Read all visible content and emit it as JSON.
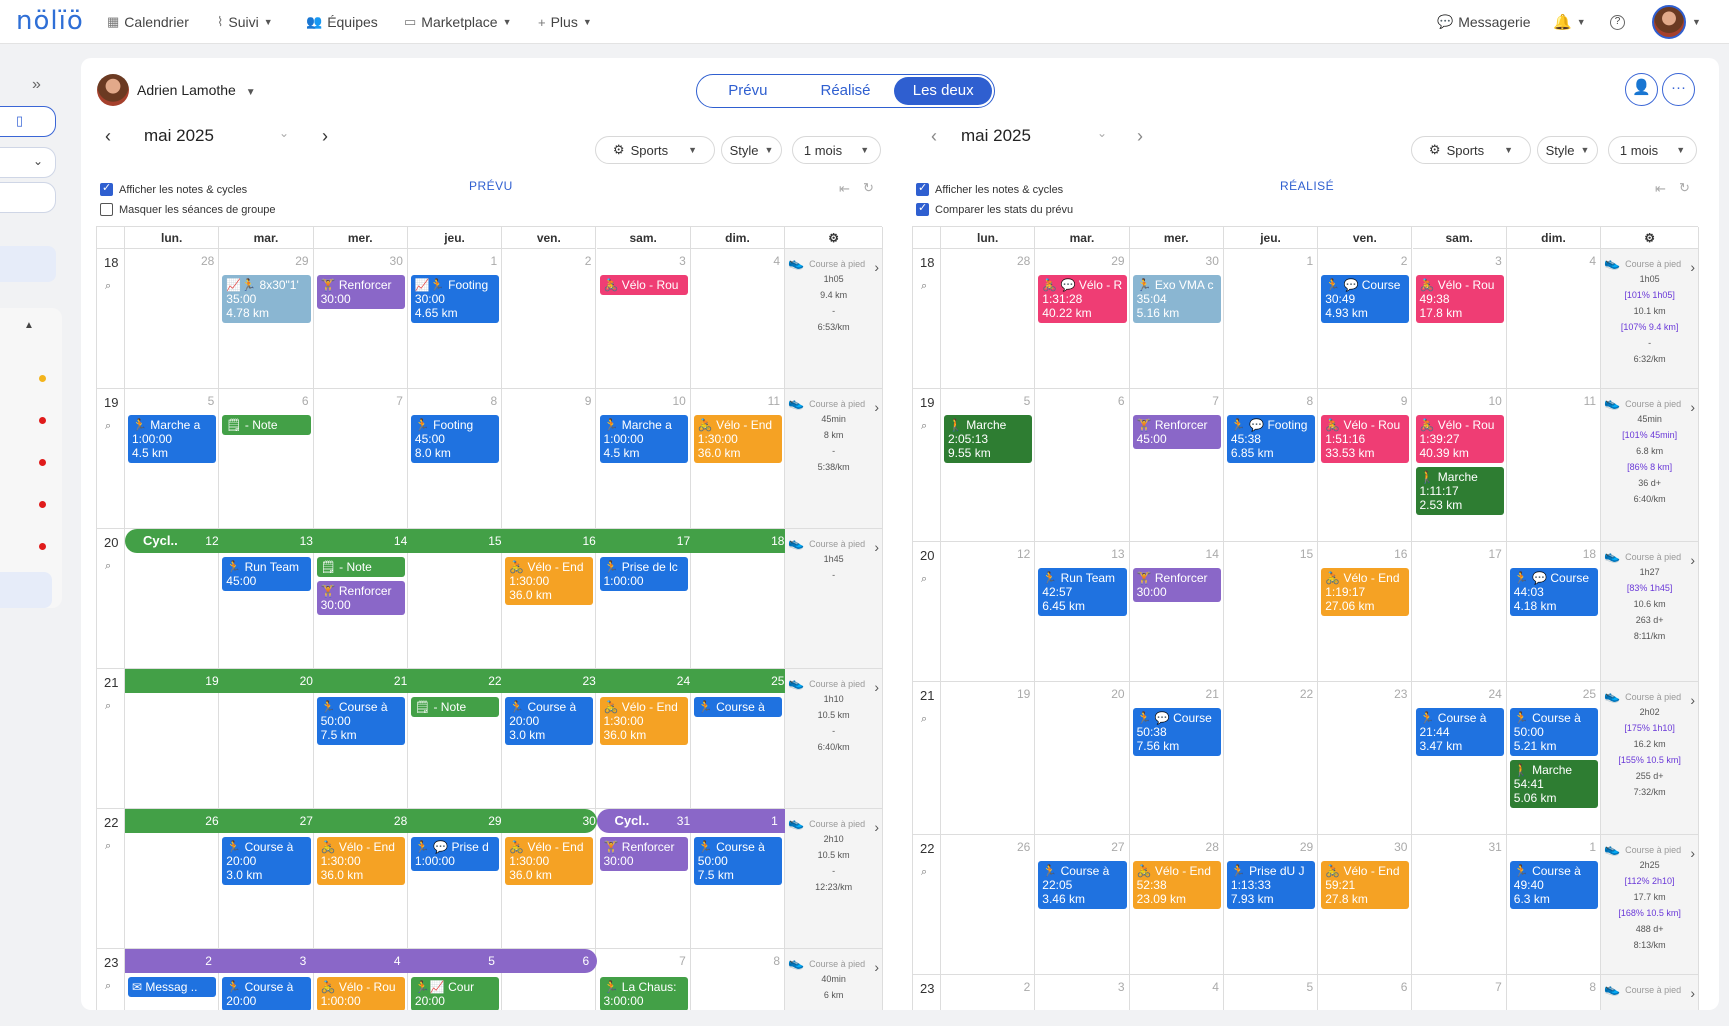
{
  "topbar": {
    "logo": "nölïö",
    "nav": [
      {
        "label": "Calendrier",
        "icon": "calendar-icon"
      },
      {
        "label": "Suivi",
        "icon": "chart-icon"
      },
      {
        "label": "Équipes",
        "icon": "team-icon"
      },
      {
        "label": "Marketplace",
        "icon": "shop-icon"
      },
      {
        "label": "Plus",
        "icon": "plus-icon"
      }
    ],
    "messaging": "Messagerie"
  },
  "athlete": "Adrien Lamothe",
  "view_toggle": [
    "Prévu",
    "Réalisé",
    "Les deux"
  ],
  "month": "mai 2025",
  "filters": {
    "sports": "Sports",
    "style": "Style",
    "period": "1 mois"
  },
  "left": {
    "title": "PRÉVU",
    "check1": "Afficher les notes & cycles",
    "check2": "Masquer les séances de groupe"
  },
  "right": {
    "title": "RÉALISÉ",
    "check1": "Afficher les notes & cycles",
    "check2": "Comparer les stats du prévu"
  },
  "weekdays": [
    "lun.",
    "mar.",
    "mer.",
    "jeu.",
    "ven.",
    "sam.",
    "dim."
  ],
  "colors": {
    "blue": "#1f72e0",
    "purple": "#8a67c8",
    "pink": "#ef3d74",
    "orange": "#f5a224",
    "light_blue": "#8ab6d2",
    "dark_green": "#2e7d32",
    "green": "#43a047"
  },
  "plan": {
    "weeks": [
      {
        "num": "18",
        "days": [
          "28",
          "29",
          "30",
          "1",
          "2",
          "3",
          "4"
        ],
        "stats": [
          "Course à pied",
          "1h05",
          "9.4 km",
          "-",
          "6:53/km"
        ],
        "events": [
          {
            "d": 1,
            "c": "lblue",
            "lines": [
              "📈🏃 8x30\"1'",
              "35:00",
              "4.78 km"
            ]
          },
          {
            "d": 2,
            "c": "purple",
            "lines": [
              "🏋 Renforcer",
              "30:00"
            ]
          },
          {
            "d": 3,
            "c": "blue",
            "lines": [
              "📈🏃 Footing",
              "30:00",
              "4.65 km"
            ]
          },
          {
            "d": 5,
            "c": "pink",
            "lines": [
              "🚴 Vélo - Rou"
            ]
          }
        ]
      },
      {
        "num": "19",
        "days": [
          "5",
          "6",
          "7",
          "8",
          "9",
          "10",
          "11"
        ],
        "stats": [
          "Course à pied",
          "45min",
          "8 km",
          "-",
          "5:38/km"
        ],
        "events": [
          {
            "d": 0,
            "c": "blue",
            "lines": [
              "🏃 Marche a",
              "1:00:00",
              "4.5 km"
            ]
          },
          {
            "d": 1,
            "c": "green",
            "lines": [
              "🗒 - Note"
            ]
          },
          {
            "d": 3,
            "c": "blue",
            "lines": [
              "🏃 Footing",
              "45:00",
              "8.0 km"
            ]
          },
          {
            "d": 5,
            "c": "blue",
            "lines": [
              "🏃 Marche a",
              "1:00:00",
              "4.5 km"
            ]
          },
          {
            "d": 6,
            "c": "orange",
            "lines": [
              "🚴 Vélo - End",
              "1:30:00",
              "36.0 km"
            ]
          }
        ]
      },
      {
        "num": "20",
        "days": [
          "12",
          "13",
          "14",
          "15",
          "16",
          "17",
          "18"
        ],
        "stats": [
          "Course à pied",
          "1h45",
          "-"
        ],
        "band": {
          "label": "Cycl..",
          "color": "green",
          "from": 0,
          "to": 6
        },
        "events": [
          {
            "d": 1,
            "c": "blue",
            "lines": [
              "🏃 Run Team",
              "45:00"
            ]
          },
          {
            "d": 2,
            "c": "green",
            "lines": [
              "🗒 - Note"
            ]
          },
          {
            "d": 2,
            "c": "purple",
            "row": 1,
            "lines": [
              "🏋 Renforcer",
              "30:00"
            ]
          },
          {
            "d": 4,
            "c": "orange",
            "lines": [
              "🚴 Vélo - End",
              "1:30:00",
              "36.0 km"
            ]
          },
          {
            "d": 5,
            "c": "blue",
            "lines": [
              "🏃 Prise de lc",
              "1:00:00"
            ]
          }
        ]
      },
      {
        "num": "21",
        "days": [
          "19",
          "20",
          "21",
          "22",
          "23",
          "24",
          "25"
        ],
        "stats": [
          "Course à pied",
          "1h10",
          "10.5 km",
          "-",
          "6:40/km"
        ],
        "band": {
          "label": "",
          "color": "green",
          "from": 0,
          "to": 6
        },
        "events": [
          {
            "d": 2,
            "c": "blue",
            "lines": [
              "🏃 Course à",
              "50:00",
              "7.5 km"
            ]
          },
          {
            "d": 3,
            "c": "green",
            "lines": [
              "🗒 - Note"
            ]
          },
          {
            "d": 4,
            "c": "blue",
            "lines": [
              "🏃 Course à",
              "20:00",
              "3.0 km"
            ]
          },
          {
            "d": 5,
            "c": "orange",
            "lines": [
              "🚴 Vélo - End",
              "1:30:00",
              "36.0 km"
            ]
          },
          {
            "d": 6,
            "c": "blue",
            "lines": [
              "🏃 Course à"
            ]
          }
        ]
      },
      {
        "num": "22",
        "days": [
          "26",
          "27",
          "28",
          "29",
          "30",
          "31",
          "1"
        ],
        "stats": [
          "Course à pied",
          "2h10",
          "10.5 km",
          "-",
          "12:23/km"
        ],
        "band": {
          "label": "",
          "color": "green",
          "from": 0,
          "to": 4
        },
        "band2": {
          "label": "Cycl..",
          "color": "purple",
          "from": 5,
          "to": 6
        },
        "events": [
          {
            "d": 1,
            "c": "blue",
            "lines": [
              "🏃 Course à",
              "20:00",
              "3.0 km"
            ]
          },
          {
            "d": 2,
            "c": "orange",
            "lines": [
              "🚴 Vélo - End",
              "1:30:00",
              "36.0 km"
            ]
          },
          {
            "d": 3,
            "c": "blue",
            "lines": [
              "🏃 💬 Prise d",
              "1:00:00"
            ]
          },
          {
            "d": 4,
            "c": "orange",
            "lines": [
              "🚴 Vélo - End",
              "1:30:00",
              "36.0 km"
            ]
          },
          {
            "d": 5,
            "c": "purple",
            "lines": [
              "🏋 Renforcer",
              "30:00"
            ]
          },
          {
            "d": 6,
            "c": "blue",
            "lines": [
              "🏃 Course à",
              "50:00",
              "7.5 km"
            ]
          }
        ]
      },
      {
        "num": "23",
        "days": [
          "2",
          "3",
          "4",
          "5",
          "6",
          "7",
          "8"
        ],
        "stats": [
          "Course à pied",
          "40min",
          "6 km"
        ],
        "band": {
          "label": "",
          "color": "purple",
          "from": 0,
          "to": 4
        },
        "events": [
          {
            "d": 0,
            "c": "blue",
            "lines": [
              "✉ Messag .."
            ]
          },
          {
            "d": 1,
            "c": "blue",
            "lines": [
              "🏃 Course à",
              "20:00"
            ]
          },
          {
            "d": 2,
            "c": "orange",
            "lines": [
              "🚴 Vélo - Rou",
              "1:00:00"
            ]
          },
          {
            "d": 3,
            "c": "green",
            "lines": [
              "🏃📈 Cour",
              "20:00"
            ]
          },
          {
            "d": 5,
            "c": "green",
            "lines": [
              "🏃 La Chaus:",
              "3:00:00"
            ]
          }
        ]
      }
    ]
  },
  "done": {
    "weeks": [
      {
        "num": "18",
        "days": [
          "28",
          "29",
          "30",
          "1",
          "2",
          "3",
          "4"
        ],
        "stats": [
          "Course à pied",
          "1h05",
          "[101% 1h05]",
          "10.1 km",
          "[107% 9.4 km]",
          "-",
          "6:32/km"
        ],
        "events": [
          {
            "d": 1,
            "c": "pink",
            "lines": [
              "🚴 💬 Vélo - R",
              "1:31:28",
              "40.22 km"
            ]
          },
          {
            "d": 2,
            "c": "lblue",
            "lines": [
              "🏃 Exo VMA c",
              "35:04",
              "5.16 km"
            ]
          },
          {
            "d": 4,
            "c": "blue",
            "lines": [
              "🏃 💬 Course",
              "30:49",
              "4.93 km"
            ]
          },
          {
            "d": 5,
            "c": "pink",
            "lines": [
              "🚴 Vélo - Rou",
              "49:38",
              "17.8 km"
            ]
          }
        ]
      },
      {
        "num": "19",
        "days": [
          "5",
          "6",
          "7",
          "8",
          "9",
          "10",
          "11"
        ],
        "stats": [
          "Course à pied",
          "45min",
          "[101% 45min]",
          "6.8 km",
          "[86% 8 km]",
          "36 d+",
          "6:40/km"
        ],
        "events": [
          {
            "d": 0,
            "c": "dgreen",
            "lines": [
              "🚶 Marche",
              "2:05:13",
              "9.55 km"
            ]
          },
          {
            "d": 2,
            "c": "purple",
            "lines": [
              "🏋 Renforcer",
              "45:00"
            ]
          },
          {
            "d": 3,
            "c": "blue",
            "lines": [
              "🏃 💬 Footing",
              "45:38",
              "6.85 km"
            ]
          },
          {
            "d": 4,
            "c": "pink",
            "lines": [
              "🚴 Vélo - Rou",
              "1:51:16",
              "33.53 km"
            ]
          },
          {
            "d": 5,
            "c": "pink",
            "lines": [
              "🚴 Vélo - Rou",
              "1:39:27",
              "40.39 km"
            ]
          },
          {
            "d": 5,
            "c": "dgreen",
            "row": 1,
            "lines": [
              "🚶 Marche",
              "1:11:17",
              "2.53 km"
            ]
          }
        ]
      },
      {
        "num": "20",
        "days": [
          "12",
          "13",
          "14",
          "15",
          "16",
          "17",
          "18"
        ],
        "stats": [
          "Course à pied",
          "1h27",
          "[83% 1h45]",
          "10.6 km",
          "263 d+",
          "8:11/km"
        ],
        "events": [
          {
            "d": 1,
            "c": "blue",
            "lines": [
              "🏃 Run Team",
              "42:57",
              "6.45 km"
            ]
          },
          {
            "d": 2,
            "c": "purple",
            "lines": [
              "🏋 Renforcer",
              "30:00"
            ]
          },
          {
            "d": 4,
            "c": "orange",
            "lines": [
              "🚴 Vélo - End",
              "1:19:17",
              "27.06 km"
            ]
          },
          {
            "d": 6,
            "c": "blue",
            "lines": [
              "🏃 💬 Course",
              "44:03",
              "4.18 km"
            ]
          }
        ]
      },
      {
        "num": "21",
        "days": [
          "19",
          "20",
          "21",
          "22",
          "23",
          "24",
          "25"
        ],
        "stats": [
          "Course à pied",
          "2h02",
          "[175% 1h10]",
          "16.2 km",
          "[155% 10.5 km]",
          "255 d+",
          "7:32/km"
        ],
        "events": [
          {
            "d": 2,
            "c": "blue",
            "lines": [
              "🏃 💬 Course",
              "50:38",
              "7.56 km"
            ]
          },
          {
            "d": 5,
            "c": "blue",
            "lines": [
              "🏃 Course à",
              "21:44",
              "3.47 km"
            ]
          },
          {
            "d": 6,
            "c": "blue",
            "lines": [
              "🏃 Course à",
              "50:00",
              "5.21 km"
            ]
          },
          {
            "d": 6,
            "c": "dgreen",
            "row": 1,
            "lines": [
              "🚶 Marche",
              "54:41",
              "5.06 km"
            ]
          }
        ]
      },
      {
        "num": "22",
        "days": [
          "26",
          "27",
          "28",
          "29",
          "30",
          "31",
          "1"
        ],
        "stats": [
          "Course à pied",
          "2h25",
          "[112% 2h10]",
          "17.7 km",
          "[168% 10.5 km]",
          "488 d+",
          "8:13/km"
        ],
        "events": [
          {
            "d": 1,
            "c": "blue",
            "lines": [
              "🏃 Course à",
              "22:05",
              "3.46 km"
            ]
          },
          {
            "d": 2,
            "c": "orange",
            "lines": [
              "🚴 Vélo - End",
              "52:38",
              "23.09 km"
            ]
          },
          {
            "d": 3,
            "c": "blue",
            "lines": [
              "🏃 Prise dU J",
              "1:13:33",
              "7.93 km"
            ]
          },
          {
            "d": 4,
            "c": "orange",
            "lines": [
              "🚴 Vélo - End",
              "59:21",
              "27.8 km"
            ]
          },
          {
            "d": 6,
            "c": "blue",
            "lines": [
              "🏃 Course à",
              "49:40",
              "6.3 km"
            ]
          }
        ]
      },
      {
        "num": "23",
        "days": [
          "2",
          "3",
          "4",
          "5",
          "6",
          "7",
          "8"
        ],
        "stats": [
          "Course à pied"
        ],
        "events": []
      }
    ]
  }
}
